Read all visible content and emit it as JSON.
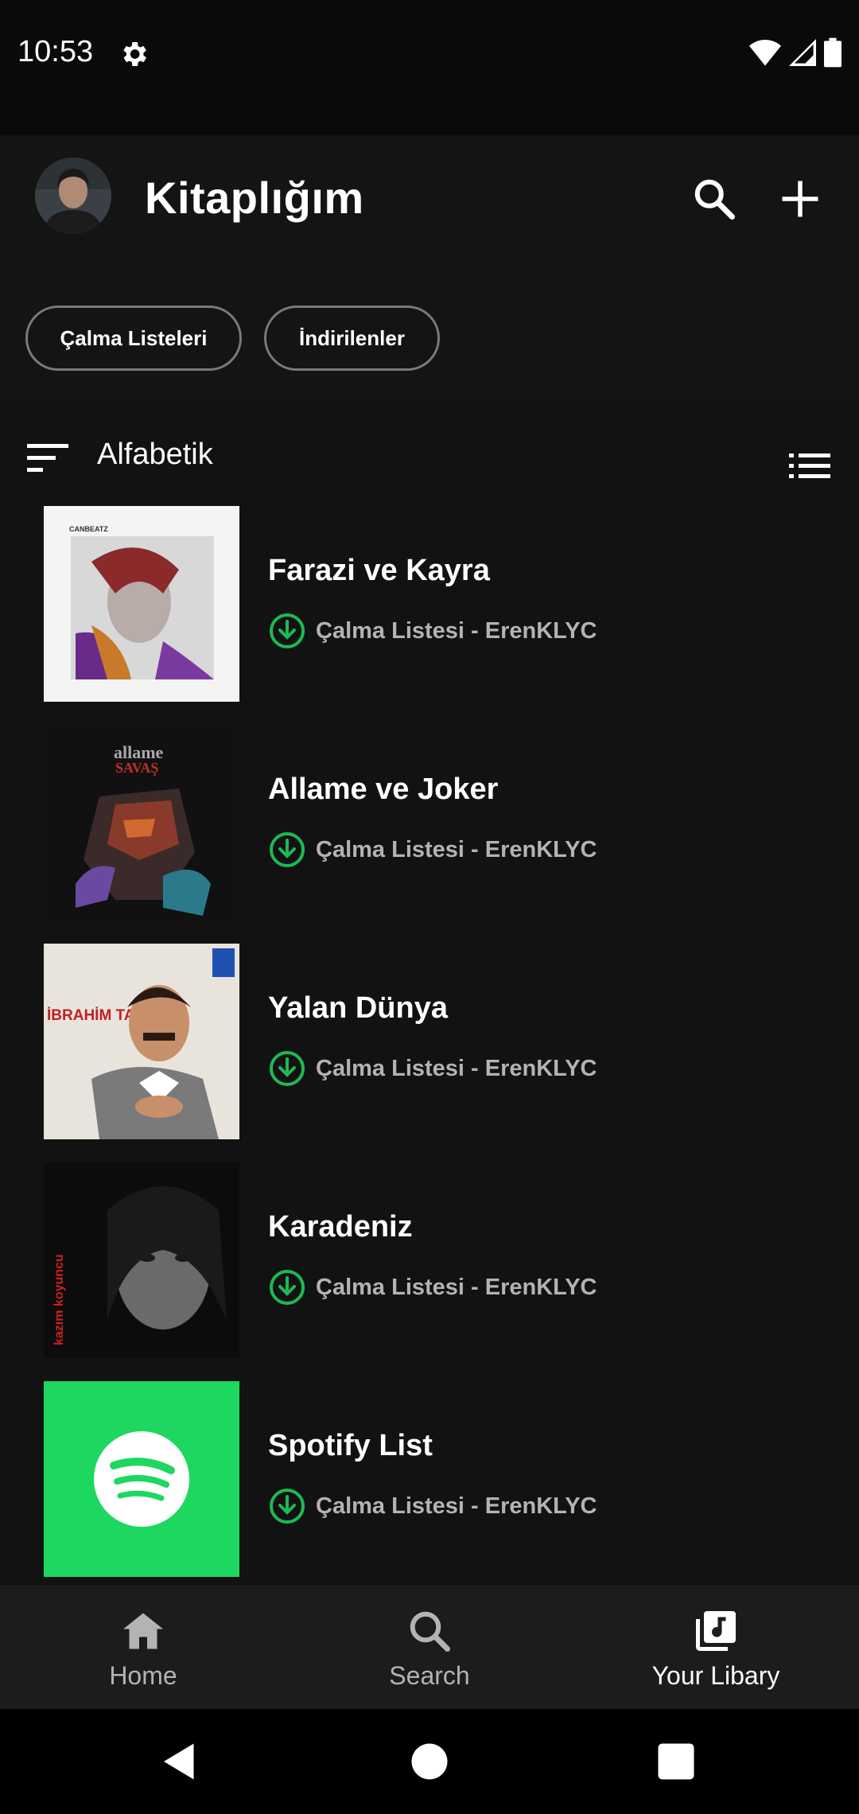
{
  "status_bar": {
    "time": "10:53"
  },
  "header": {
    "title": "Kitaplığım",
    "filters": [
      "Çalma Listeleri",
      "İndirilenler"
    ]
  },
  "sort": {
    "label": "Alfabetik"
  },
  "playlists": [
    {
      "title": "Farazi ve Kayra",
      "subtitle": "Çalma Listesi - ErenKLYC",
      "cover_text": "CANBEATZ"
    },
    {
      "title": "Allame ve Joker",
      "subtitle": "Çalma Listesi - ErenKLYC",
      "cover_text": "SAVAŞ"
    },
    {
      "title": "Yalan Dünya",
      "subtitle": "Çalma Listesi - ErenKLYC",
      "cover_text": "İBRAHİM TATLISES"
    },
    {
      "title": "Karadeniz",
      "subtitle": "Çalma Listesi - ErenKLYC",
      "cover_text": "kazım koyuncu"
    },
    {
      "title": "Spotify List",
      "subtitle": "Çalma Listesi - ErenKLYC",
      "cover_text": ""
    }
  ],
  "bottom_nav": [
    {
      "label": "Home",
      "icon": "home-icon",
      "active": false
    },
    {
      "label": "Search",
      "icon": "search-icon",
      "active": false
    },
    {
      "label": "Your Libary",
      "icon": "library-icon",
      "active": true
    }
  ],
  "colors": {
    "accent_green": "#1ed760",
    "download_green": "#1db954",
    "background": "#121212",
    "inactive_text": "#b3b3b3"
  }
}
